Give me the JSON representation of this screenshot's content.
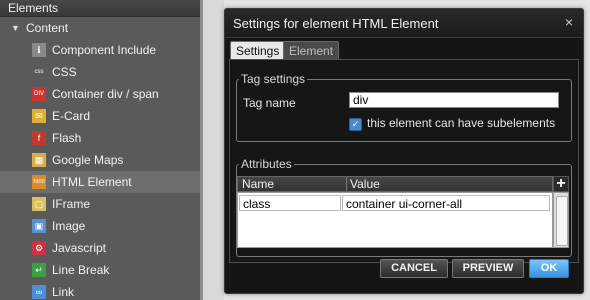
{
  "left_panel": {
    "header": "Elements",
    "category": "Content",
    "items": [
      {
        "label": "Component Include",
        "icon": "component-include-icon",
        "glyph": "ℹ",
        "color": "#8a8a8a"
      },
      {
        "label": "CSS",
        "icon": "css-icon",
        "glyph": "css",
        "color": "#5a5a5a"
      },
      {
        "label": "Container div / span",
        "icon": "container-div-icon",
        "glyph": "DIV",
        "color": "#cc3333"
      },
      {
        "label": "E-Card",
        "icon": "ecard-icon",
        "glyph": "✉",
        "color": "#e0b030"
      },
      {
        "label": "Flash",
        "icon": "flash-icon",
        "glyph": "f",
        "color": "#c0392b"
      },
      {
        "label": "Google Maps",
        "icon": "google-maps-icon",
        "glyph": "▦",
        "color": "#d8b04a"
      },
      {
        "label": "HTML Element",
        "icon": "html-element-icon",
        "glyph": "html",
        "color": "#d98b2a"
      },
      {
        "label": "IFrame",
        "icon": "iframe-icon",
        "glyph": "▢",
        "color": "#d8c060"
      },
      {
        "label": "Image",
        "icon": "image-icon",
        "glyph": "▣",
        "color": "#5a8fd0"
      },
      {
        "label": "Javascript",
        "icon": "javascript-icon",
        "glyph": "⚙",
        "color": "#cc3344"
      },
      {
        "label": "Line Break",
        "icon": "line-break-icon",
        "glyph": "↵",
        "color": "#3aa040"
      },
      {
        "label": "Link",
        "icon": "link-icon",
        "glyph": "∞",
        "color": "#4a90d9"
      }
    ],
    "selected": "HTML Element"
  },
  "dialog": {
    "title": "Settings for element HTML Element",
    "close_glyph": "×",
    "tabs": [
      "Settings",
      "Element"
    ],
    "active_tab": "Settings",
    "tag_settings": {
      "legend": "Tag settings",
      "tag_name_label": "Tag name",
      "tag_name_value": "div",
      "subelements_label": "this element can have subelements",
      "subelements_checked": true
    },
    "attributes": {
      "legend": "Attributes",
      "columns": [
        "Name",
        "Value"
      ],
      "add_glyph": "+",
      "rows": [
        {
          "name": "class",
          "value": "container ui-corner-all"
        }
      ]
    },
    "buttons": {
      "cancel": "CANCEL",
      "preview": "PREVIEW",
      "ok": "OK"
    }
  }
}
